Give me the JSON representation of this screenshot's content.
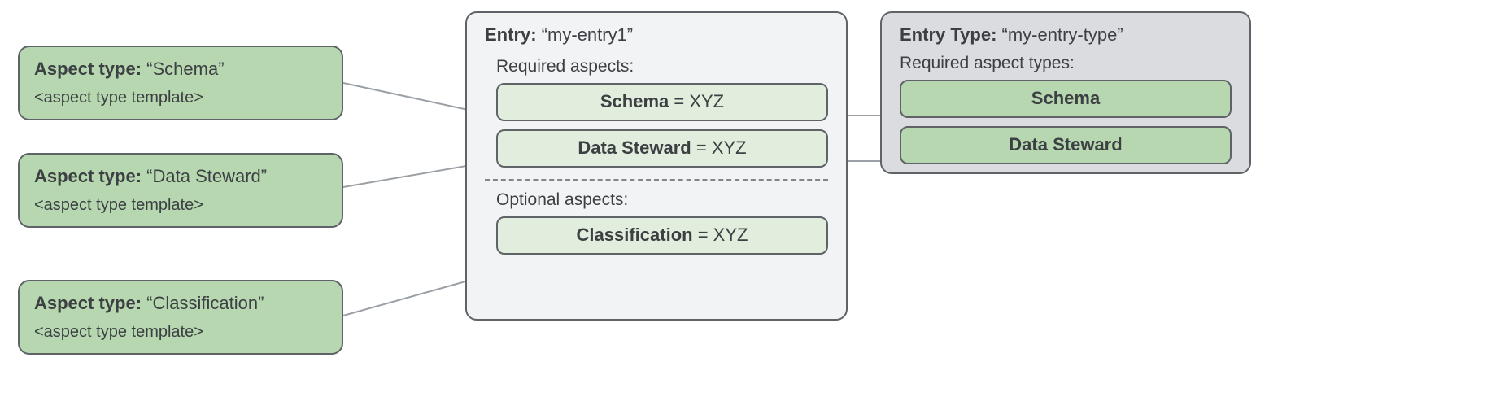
{
  "aspect_types": [
    {
      "label_prefix": "Aspect type:",
      "name": "“Schema”",
      "template": "<aspect type template>"
    },
    {
      "label_prefix": "Aspect type:",
      "name": "“Data Steward”",
      "template": "<aspect type template>"
    },
    {
      "label_prefix": "Aspect type:",
      "name": "“Classification”",
      "template": "<aspect type template>"
    }
  ],
  "entry": {
    "label": "Entry:",
    "name": "“my-entry1”",
    "required_label": "Required aspects:",
    "optional_label": "Optional aspects:",
    "required": [
      {
        "key": "Schema",
        "eq": " = ",
        "val": "XYZ"
      },
      {
        "key": "Data Steward",
        "eq": " = ",
        "val": "XYZ"
      }
    ],
    "optional": [
      {
        "key": "Classification",
        "eq": " = ",
        "val": "XYZ"
      }
    ]
  },
  "entry_type": {
    "label": "Entry Type:",
    "name": "“my-entry-type”",
    "required_label": "Required aspect types:",
    "required": [
      "Schema",
      "Data Steward"
    ]
  }
}
